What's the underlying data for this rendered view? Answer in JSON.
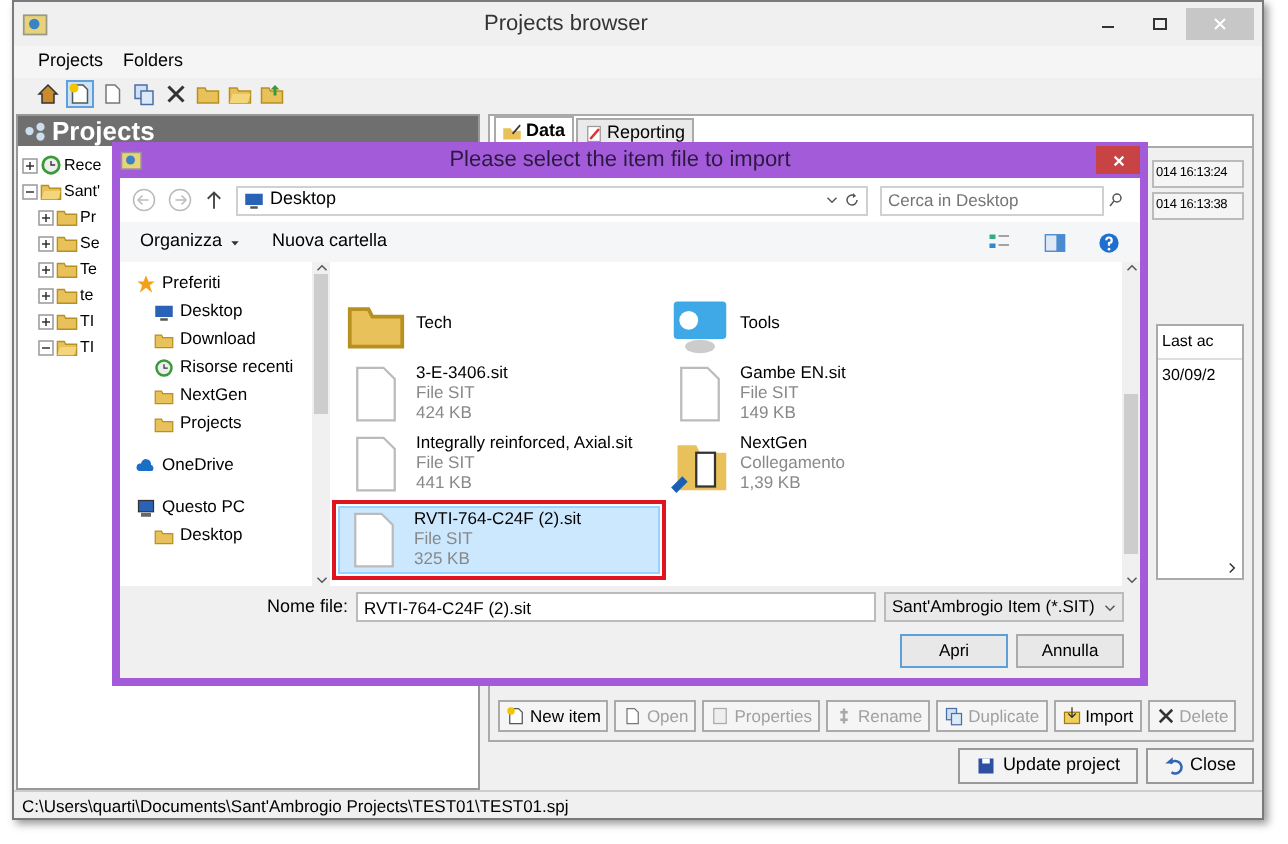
{
  "window": {
    "title": "Projects browser"
  },
  "menu": [
    {
      "label": "Projects"
    },
    {
      "label": "Folders"
    }
  ],
  "toolbar": [
    {
      "kind": "home",
      "selected": false
    },
    {
      "kind": "new",
      "selected": true
    },
    {
      "kind": "open",
      "selected": false
    },
    {
      "kind": "copy",
      "selected": false
    },
    {
      "kind": "delete",
      "selected": false
    },
    {
      "kind": "folder",
      "selected": false
    },
    {
      "kind": "folder-open",
      "selected": false
    },
    {
      "kind": "folder-up",
      "selected": false
    }
  ],
  "projects_panel": {
    "title": "Projects",
    "tree": [
      {
        "label": "Rece",
        "kind": "recent",
        "expanded": false
      },
      {
        "label": "Sant'",
        "kind": "folder",
        "expanded": true,
        "children": [
          {
            "label": "Pr",
            "kind": "folder",
            "expanded": false
          },
          {
            "label": "Se",
            "kind": "folder",
            "expanded": false
          },
          {
            "label": "Te",
            "kind": "folder",
            "expanded": false
          },
          {
            "label": "te",
            "kind": "folder",
            "expanded": false
          },
          {
            "label": "TI",
            "kind": "folder",
            "expanded": false
          },
          {
            "label": "TI",
            "kind": "folder",
            "expanded": true
          }
        ]
      }
    ]
  },
  "tabs": [
    {
      "label": "Data",
      "kind": "data",
      "selected": true
    },
    {
      "label": "Reporting",
      "kind": "report",
      "selected": false
    }
  ],
  "date_fields": [
    "014 16:13:24",
    "014 16:13:38"
  ],
  "item_list": {
    "column_header": "Last ac",
    "cells": [
      "30/09/2"
    ]
  },
  "item_buttons": [
    {
      "label": "New item",
      "kind": "new",
      "disabled": false
    },
    {
      "label": "Open",
      "kind": "open",
      "disabled": true
    },
    {
      "label": "Properties",
      "kind": "props",
      "disabled": true
    },
    {
      "label": "Rename",
      "kind": "rename",
      "disabled": true
    },
    {
      "label": "Duplicate",
      "kind": "copy",
      "disabled": true
    },
    {
      "label": "Import",
      "kind": "import",
      "disabled": false
    },
    {
      "label": "Delete",
      "kind": "delete",
      "disabled": true
    }
  ],
  "footer_buttons": [
    {
      "label": "Update project",
      "kind": "save"
    },
    {
      "label": "Close",
      "kind": "undo"
    }
  ],
  "status_bar": {
    "path": "C:\\Users\\quarti\\Documents\\Sant'Ambrogio Projects\\TEST01\\TEST01.spj"
  },
  "dialog": {
    "title": "Please select the item file to import",
    "address": "Desktop",
    "search": {
      "placeholder": "Cerca in Desktop"
    },
    "commands": [
      {
        "label": "Organizza",
        "kind": "menu"
      },
      {
        "label": "Nuova cartella",
        "kind": "plain"
      }
    ],
    "nav": [
      {
        "label": "Preferiti",
        "kind": "star",
        "children": [
          {
            "label": "Desktop",
            "kind": "desktop"
          },
          {
            "label": "Download",
            "kind": "folder"
          },
          {
            "label": "Risorse recenti",
            "kind": "recent"
          },
          {
            "label": "NextGen",
            "kind": "folder"
          },
          {
            "label": "Projects",
            "kind": "folder"
          }
        ]
      },
      {
        "label": "OneDrive",
        "kind": "cloud"
      },
      {
        "label": "Questo PC",
        "kind": "pc",
        "children": [
          {
            "label": "Desktop",
            "kind": "folder"
          }
        ]
      }
    ],
    "files": [
      {
        "name": "Tech",
        "kind": "folder",
        "selected": false
      },
      {
        "name": "Tools",
        "kind": "app",
        "selected": false
      },
      {
        "name": "3-E-3406.sit",
        "type": "File SIT",
        "size": "424 KB",
        "kind": "file",
        "selected": false
      },
      {
        "name": "Gambe EN.sit",
        "type": "File SIT",
        "size": "149 KB",
        "kind": "file",
        "selected": false
      },
      {
        "name": "Integrally reinforced, Axial.sit",
        "type": "File SIT",
        "size": "441 KB",
        "kind": "file",
        "selected": false
      },
      {
        "name": "NextGen",
        "type": "Collegamento",
        "size": "1,39 KB",
        "kind": "shortcut",
        "selected": false
      },
      {
        "name": "RVTI-764-C24F (2).sit",
        "type": "File SIT",
        "size": "325 KB",
        "kind": "file",
        "selected": true
      }
    ],
    "file_name_label": "Nome file:",
    "file_name": "RVTI-764-C24F (2).sit",
    "file_type": "Sant'Ambrogio Item (*.SIT)",
    "buttons": [
      {
        "label": "Apri",
        "kind": "default"
      },
      {
        "label": "Annulla",
        "kind": "plain"
      }
    ]
  }
}
